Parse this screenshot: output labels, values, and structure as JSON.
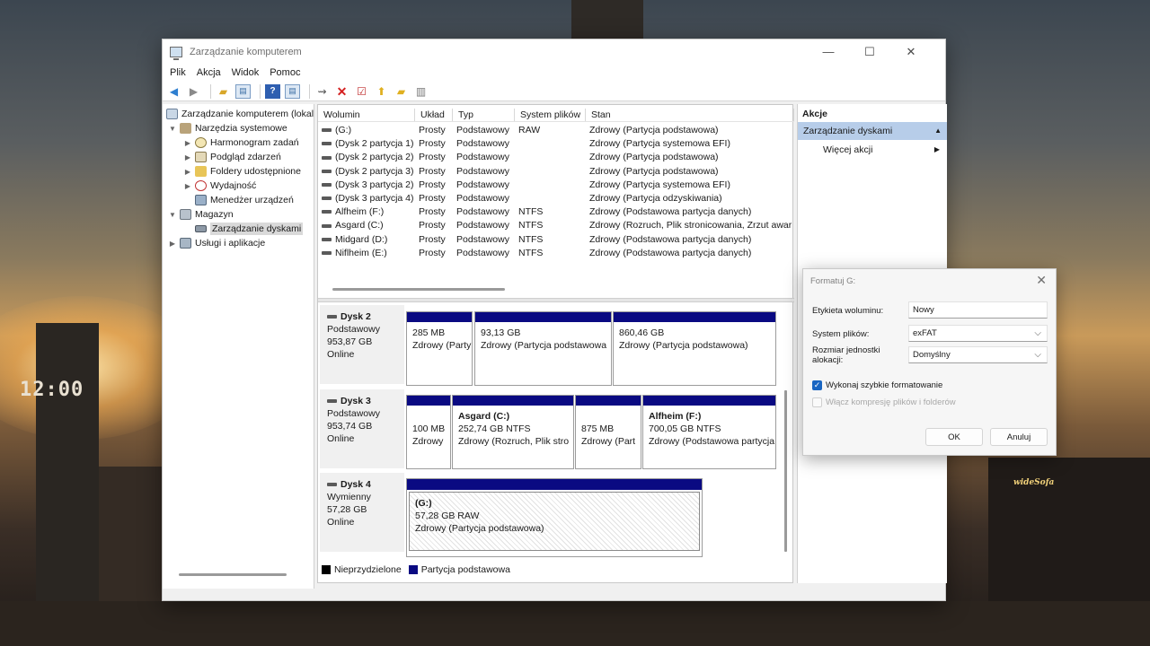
{
  "window": {
    "title": "Zarządzanie komputerem",
    "minimize": "—",
    "maximize": "☐",
    "close": "✕"
  },
  "menu": [
    "Plik",
    "Akcja",
    "Widok",
    "Pomoc"
  ],
  "tree": [
    {
      "label": "Zarządzanie komputerem (lokal",
      "icon": "computer-management-icon"
    },
    {
      "label": "Narzędzia systemowe",
      "icon": "tools-icon"
    },
    {
      "label": "Harmonogram zadań",
      "icon": "clock-icon"
    },
    {
      "label": "Podgląd zdarzeń",
      "icon": "event-viewer-icon"
    },
    {
      "label": "Foldery udostępnione",
      "icon": "shared-folder-icon"
    },
    {
      "label": "Wydajność",
      "icon": "performance-icon"
    },
    {
      "label": "Menedżer urządzeń",
      "icon": "device-manager-icon"
    },
    {
      "label": "Magazyn",
      "icon": "storage-icon"
    },
    {
      "label": "Zarządzanie dyskami",
      "icon": "disk-management-icon"
    },
    {
      "label": "Usługi i aplikacje",
      "icon": "services-icon"
    }
  ],
  "volumes": {
    "headers": [
      "Wolumin",
      "Układ",
      "Typ",
      "System plików",
      "Stan"
    ],
    "rows": [
      [
        "(G:)",
        "Prosty",
        "Podstawowy",
        "RAW",
        "Zdrowy (Partycja podstawowa)"
      ],
      [
        "(Dysk 2 partycja 1)",
        "Prosty",
        "Podstawowy",
        "",
        "Zdrowy (Partycja systemowa EFI)"
      ],
      [
        "(Dysk 2 partycja 2)",
        "Prosty",
        "Podstawowy",
        "",
        "Zdrowy (Partycja podstawowa)"
      ],
      [
        "(Dysk 2 partycja 3)",
        "Prosty",
        "Podstawowy",
        "",
        "Zdrowy (Partycja podstawowa)"
      ],
      [
        "(Dysk 3 partycja 2)",
        "Prosty",
        "Podstawowy",
        "",
        "Zdrowy (Partycja systemowa EFI)"
      ],
      [
        "(Dysk 3 partycja 4)",
        "Prosty",
        "Podstawowy",
        "",
        "Zdrowy (Partycja odzyskiwania)"
      ],
      [
        "Alfheim (F:)",
        "Prosty",
        "Podstawowy",
        "NTFS",
        "Zdrowy (Podstawowa partycja danych)"
      ],
      [
        "Asgard (C:)",
        "Prosty",
        "Podstawowy",
        "NTFS",
        "Zdrowy (Rozruch, Plik stronicowania, Zrzut awar"
      ],
      [
        "Midgard (D:)",
        "Prosty",
        "Podstawowy",
        "NTFS",
        "Zdrowy (Podstawowa partycja danych)"
      ],
      [
        "Niflheim (E:)",
        "Prosty",
        "Podstawowy",
        "NTFS",
        "Zdrowy (Podstawowa partycja danych)"
      ]
    ]
  },
  "disks": [
    {
      "name": "Dysk 2",
      "type": "Podstawowy",
      "size": "953,87 GB",
      "status": "Online",
      "partitions": [
        {
          "title": "",
          "size": "285 MB",
          "status": "Zdrowy (Party"
        },
        {
          "title": "",
          "size": "93,13 GB",
          "status": "Zdrowy (Partycja podstawowa"
        },
        {
          "title": "",
          "size": "860,46 GB",
          "status": "Zdrowy (Partycja podstawowa)"
        }
      ]
    },
    {
      "name": "Dysk 3",
      "type": "Podstawowy",
      "size": "953,74 GB",
      "status": "Online",
      "partitions": [
        {
          "title": "",
          "size": "100 MB",
          "status": "Zdrowy"
        },
        {
          "title": "Asgard  (C:)",
          "size": "252,74 GB NTFS",
          "status": "Zdrowy (Rozruch, Plik stro"
        },
        {
          "title": "",
          "size": "875 MB",
          "status": "Zdrowy (Part"
        },
        {
          "title": "Alfheim  (F:)",
          "size": "700,05 GB NTFS",
          "status": "Zdrowy (Podstawowa partycja"
        }
      ]
    },
    {
      "name": "Dysk 4",
      "type": "Wymienny",
      "size": "57,28 GB",
      "status": "Online",
      "partitions": [
        {
          "title": "(G:)",
          "size": "57,28 GB RAW",
          "status": "Zdrowy (Partycja podstawowa)"
        }
      ]
    }
  ],
  "legend": [
    {
      "label": "Nieprzydzielone",
      "color": "#000000"
    },
    {
      "label": "Partycja podstawowa",
      "color": "#0a0a82"
    }
  ],
  "actions": {
    "header": "Akcje",
    "section": "Zarządzanie dyskami",
    "more": "Więcej akcji"
  },
  "dialog": {
    "title": "Formatuj G:",
    "label_volume": "Etykieta woluminu:",
    "value_volume": "Nowy",
    "label_fs": "System plików:",
    "value_fs": "exFAT",
    "label_alloc": "Rozmiar jednostki alokacji:",
    "value_alloc": "Domyślny",
    "quick_format": "Wykonaj szybkie formatowanie",
    "quick_format_checked": true,
    "compression": "Włącz kompresję plików i folderów",
    "compression_checked": false,
    "ok": "OK",
    "cancel": "Anuluj"
  },
  "desktop": {
    "clock": "12:00",
    "signature": "wideSofa"
  }
}
